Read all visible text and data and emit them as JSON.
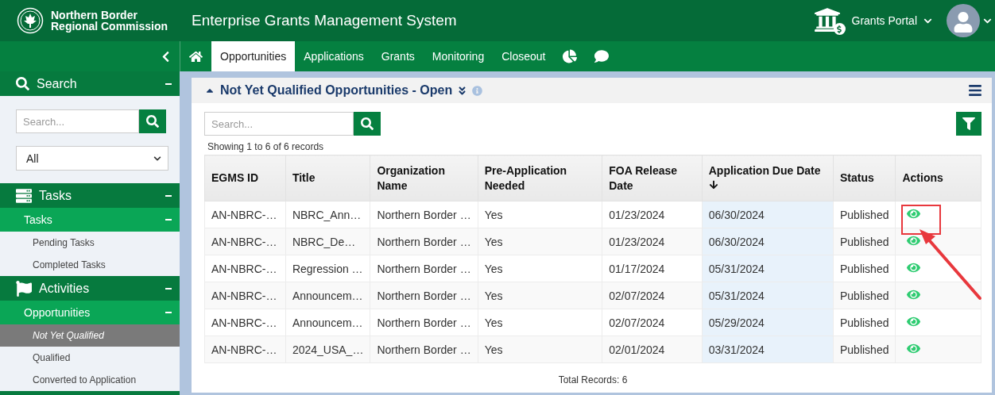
{
  "header": {
    "org_line1": "Northern Border",
    "org_line2": "Regional Commission",
    "app_title": "Enterprise Grants Management System",
    "portal_menu": "Grants Portal"
  },
  "nav": {
    "tabs": [
      {
        "label": "Opportunities",
        "selected": true
      },
      {
        "label": "Applications",
        "selected": false
      },
      {
        "label": "Grants",
        "selected": false
      },
      {
        "label": "Monitoring",
        "selected": false
      },
      {
        "label": "Closeout",
        "selected": false
      }
    ]
  },
  "sidebar": {
    "search": {
      "title": "Search",
      "expanded": true,
      "placeholder": "Search...",
      "filter_value": "All"
    },
    "sections": [
      {
        "kind": "tasks",
        "title": "Tasks",
        "expanded": true,
        "groups": [
          {
            "title": "Tasks",
            "expanded": true,
            "items": [
              {
                "label": "Pending Tasks",
                "selected": false
              },
              {
                "label": "Completed Tasks",
                "selected": false
              }
            ]
          }
        ]
      },
      {
        "kind": "activities",
        "title": "Activities",
        "expanded": true,
        "groups": [
          {
            "title": "Opportunities",
            "expanded": true,
            "items": [
              {
                "label": "Not Yet Qualified",
                "selected": true
              },
              {
                "label": "Qualified",
                "selected": false
              },
              {
                "label": "Converted to Application",
                "selected": false
              }
            ]
          }
        ]
      }
    ]
  },
  "panel": {
    "title": "Not Yet Qualified Opportunities - Open",
    "expanded": true,
    "search_placeholder": "Search...",
    "showing": "Showing 1 to 6 of 6 records",
    "total": "Total Records: 6",
    "columns": [
      {
        "label": "EGMS ID",
        "sorted": false
      },
      {
        "label": "Title",
        "sorted": false
      },
      {
        "label": "Organization Name",
        "sorted": false
      },
      {
        "label": "Pre-Application Needed",
        "sorted": false
      },
      {
        "label": "FOA Release Date",
        "sorted": false
      },
      {
        "label": "Application Due Date",
        "sorted": true
      },
      {
        "label": "Status",
        "sorted": false
      },
      {
        "label": "Actions",
        "sorted": false
      }
    ],
    "rows": [
      {
        "cells": [
          "AN-NBRC-…",
          "NBRC_Ann…",
          "Northern Border …",
          "Yes",
          "01/23/2024",
          "06/30/2024",
          "Published"
        ],
        "highlighted": true
      },
      {
        "cells": [
          "AN-NBRC-…",
          "NBRC_De…",
          "Northern Border …",
          "Yes",
          "01/23/2024",
          "06/30/2024",
          "Published"
        ],
        "highlighted": false
      },
      {
        "cells": [
          "AN-NBRC-…",
          "Regression …",
          "Northern Border …",
          "Yes",
          "01/17/2024",
          "05/31/2024",
          "Published"
        ],
        "highlighted": false
      },
      {
        "cells": [
          "AN-NBRC-…",
          "Announcem…",
          "Northern Border …",
          "Yes",
          "02/07/2024",
          "05/31/2024",
          "Published"
        ],
        "highlighted": false
      },
      {
        "cells": [
          "AN-NBRC-…",
          "Announcem…",
          "Northern Border …",
          "Yes",
          "02/07/2024",
          "05/29/2024",
          "Published"
        ],
        "highlighted": false
      },
      {
        "cells": [
          "AN-NBRC-…",
          "2024_USA_…",
          "Northern Border …",
          "Yes",
          "02/01/2024",
          "03/31/2024",
          "Published"
        ],
        "highlighted": false
      }
    ]
  }
}
